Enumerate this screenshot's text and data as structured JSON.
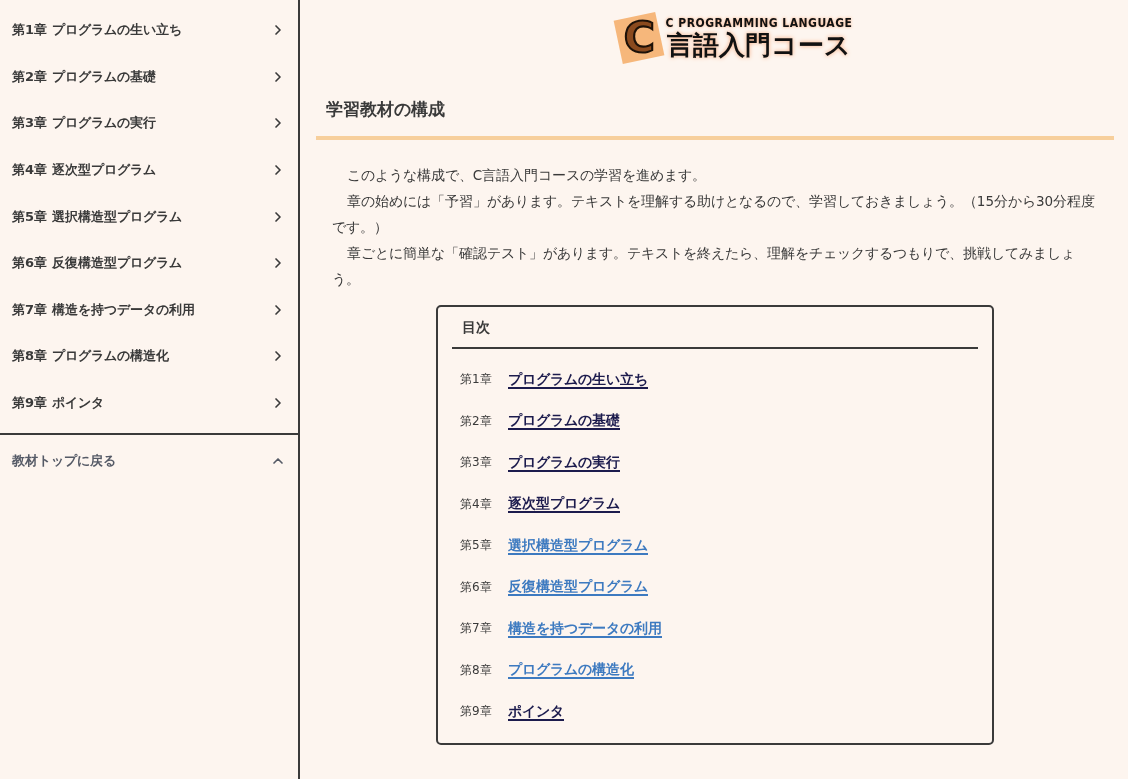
{
  "sidebar": {
    "items": [
      {
        "label": "第1章 プログラムの生い立ち"
      },
      {
        "label": "第2章 プログラムの基礎"
      },
      {
        "label": "第3章 プログラムの実行"
      },
      {
        "label": "第4章 逐次型プログラム"
      },
      {
        "label": "第5章 選択構造型プログラム"
      },
      {
        "label": "第6章 反復構造型プログラム"
      },
      {
        "label": "第7章 構造を持つデータの利用"
      },
      {
        "label": "第8章 プログラムの構造化"
      },
      {
        "label": "第9章 ポインタ"
      }
    ],
    "back": {
      "label": "教材トップに戻る",
      "expanded": true
    }
  },
  "logo": {
    "mark": "C",
    "tagline": "C PROGRAMMING LANGUAGE",
    "title": "言語入門コース"
  },
  "heading": "学習教材の構成",
  "paragraphs": [
    "このような構成で、C言語入門コースの学習を進めます。",
    "章の始めには「予習」があります。テキストを理解する助けとなるので、学習しておきましょう。（15分から30分程度です。）",
    "章ごとに簡単な「確認テスト」があります。テキストを終えたら、理解をチェックするつもりで、挑戦してみましょう。"
  ],
  "toc": {
    "title": "目次",
    "items": [
      {
        "chapter": "第1章",
        "link": "プログラムの生い立ち",
        "visited": true
      },
      {
        "chapter": "第2章",
        "link": "プログラムの基礎",
        "visited": true
      },
      {
        "chapter": "第3章",
        "link": "プログラムの実行",
        "visited": true
      },
      {
        "chapter": "第4章",
        "link": "逐次型プログラム",
        "visited": true
      },
      {
        "chapter": "第5章",
        "link": "選択構造型プログラム",
        "visited": false
      },
      {
        "chapter": "第6章",
        "link": "反復構造型プログラム",
        "visited": false
      },
      {
        "chapter": "第7章",
        "link": "構造を持つデータの利用",
        "visited": false
      },
      {
        "chapter": "第8章",
        "link": "プログラムの構造化",
        "visited": false
      },
      {
        "chapter": "第9章",
        "link": "ポインタ",
        "visited": true
      }
    ]
  }
}
